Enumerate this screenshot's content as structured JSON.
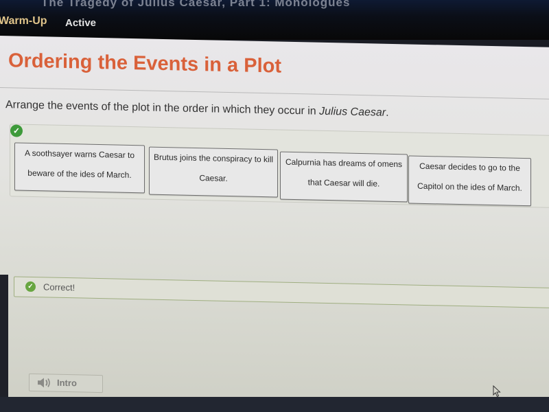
{
  "header": {
    "course_title": "The Tragedy of Julius Caesar, Part 1: Monologues",
    "tabs": [
      {
        "label": "Warm-Up",
        "color": "#e0c48a"
      },
      {
        "label": "Active",
        "color": "#e4e4e4"
      }
    ]
  },
  "main": {
    "title": "Ordering the Events in a Plot",
    "title_color": "#d9613a",
    "instructions_prefix": "Arrange the events of the plot in the order in which they occur in ",
    "instructions_work": "Julius Caesar",
    "instructions_suffix": ".",
    "answer_status_icon": "check-circle-icon",
    "events": [
      {
        "line1": "A soothsayer warns Caesar to",
        "line2": "beware of the ides of March."
      },
      {
        "line1": "Brutus joins the conspiracy to kill",
        "line2": "Caesar."
      },
      {
        "line1": "Calpurnia has dreams of omens",
        "line2": "that Caesar will die."
      },
      {
        "line1": "Caesar decides to go to the",
        "line2": "Capitol on the ides of March."
      }
    ],
    "feedback": {
      "text": "Correct!",
      "icon": "check-circle-icon",
      "color": "#68a641"
    }
  },
  "footer": {
    "intro_label": "Intro",
    "intro_icon": "speaker-icon"
  }
}
